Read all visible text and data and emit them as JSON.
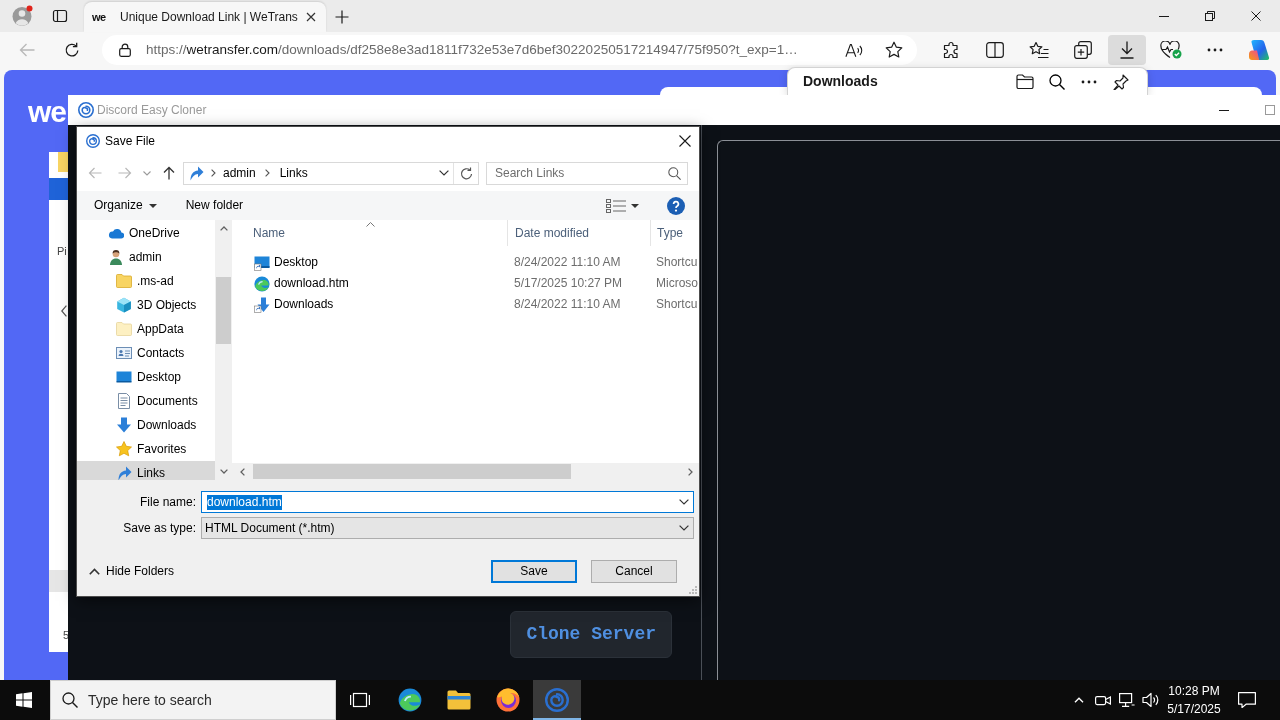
{
  "browser": {
    "tabs": [
      {
        "logo": "we",
        "title": "Unique Download Link | WeTrans",
        "selected": true
      }
    ],
    "back_disabled": true,
    "address": {
      "scheme": "https://",
      "host": "wetransfer.com",
      "path": "/downloads/df258e8e3ad1811f732e53e7d6bef30220250517214947/75f950?t_exp=1…"
    },
    "toolbar_buttons": [
      {
        "kind": "extensions",
        "active": false
      },
      {
        "kind": "split-screen",
        "active": false
      },
      {
        "kind": "favorites",
        "active": false
      },
      {
        "kind": "collections",
        "active": false
      },
      {
        "kind": "downloads",
        "active": true
      },
      {
        "kind": "essentials",
        "active": false
      },
      {
        "kind": "more",
        "active": false
      },
      {
        "kind": "assistant",
        "active": false
      }
    ],
    "downloads_panel": {
      "title": "Downloads"
    },
    "page": {
      "logo": "we",
      "card_texts": [
        "Pi",
        "5"
      ]
    }
  },
  "app_window": {
    "title": "Discord Easy Cloner",
    "clone_button": "Clone Server"
  },
  "save_dialog": {
    "title": "Save File",
    "back_disabled": true,
    "forward_disabled": true,
    "breadcrumb": [
      "admin",
      "Links"
    ],
    "search_placeholder": "Search Links",
    "organize": "Organize",
    "new_folder": "New folder",
    "tree": [
      {
        "label": "OneDrive",
        "kind": "cloud",
        "selected": false
      },
      {
        "label": "admin",
        "kind": "user",
        "selected": false,
        "children": [
          {
            "label": ".ms-ad",
            "kind": "folder",
            "selected": false
          },
          {
            "label": "3D Objects",
            "kind": "cube",
            "selected": false
          },
          {
            "label": "AppData",
            "kind": "hidden-folder",
            "selected": false
          },
          {
            "label": "Contacts",
            "kind": "contacts",
            "selected": false
          },
          {
            "label": "Desktop",
            "kind": "desktop",
            "selected": false
          },
          {
            "label": "Documents",
            "kind": "documents",
            "selected": false
          },
          {
            "label": "Downloads",
            "kind": "downloads",
            "selected": false
          },
          {
            "label": "Favorites",
            "kind": "favorites",
            "selected": false
          },
          {
            "label": "Links",
            "kind": "links",
            "selected": true
          }
        ]
      }
    ],
    "columns": [
      {
        "label": "Name",
        "sorted": true
      },
      {
        "label": "Date modified",
        "sorted": false
      },
      {
        "label": "Type",
        "sorted": false
      }
    ],
    "files": [
      {
        "name": "Desktop",
        "kind": "desktop-shortcut",
        "modified": "8/24/2022 11:10 AM",
        "type": "Shortcu",
        "selected": false
      },
      {
        "name": "download.htm",
        "kind": "web-page",
        "modified": "5/17/2025 10:27 PM",
        "type": "Microso",
        "selected": false
      },
      {
        "name": "Downloads",
        "kind": "downloads-shortcut",
        "modified": "8/24/2022 11:10 AM",
        "type": "Shortcu",
        "selected": false
      }
    ],
    "file_name": {
      "label": "File name:",
      "value": "download.htm",
      "text_selected": true
    },
    "save_as_type": {
      "label": "Save as type:",
      "value": "HTML Document (*.htm)"
    },
    "hide_folders": "Hide Folders",
    "buttons": [
      {
        "label": "Save",
        "default": true
      },
      {
        "label": "Cancel",
        "default": false
      }
    ]
  },
  "taskbar": {
    "search_placeholder": "Type here to search",
    "apps": [
      {
        "kind": "swirl-browser",
        "selected": false
      },
      {
        "kind": "file-explorer",
        "selected": false
      },
      {
        "kind": "globe-browser",
        "selected": false
      },
      {
        "kind": "spiral-app",
        "selected": true
      }
    ],
    "time": "10:28 PM",
    "date": "5/17/2025"
  }
}
